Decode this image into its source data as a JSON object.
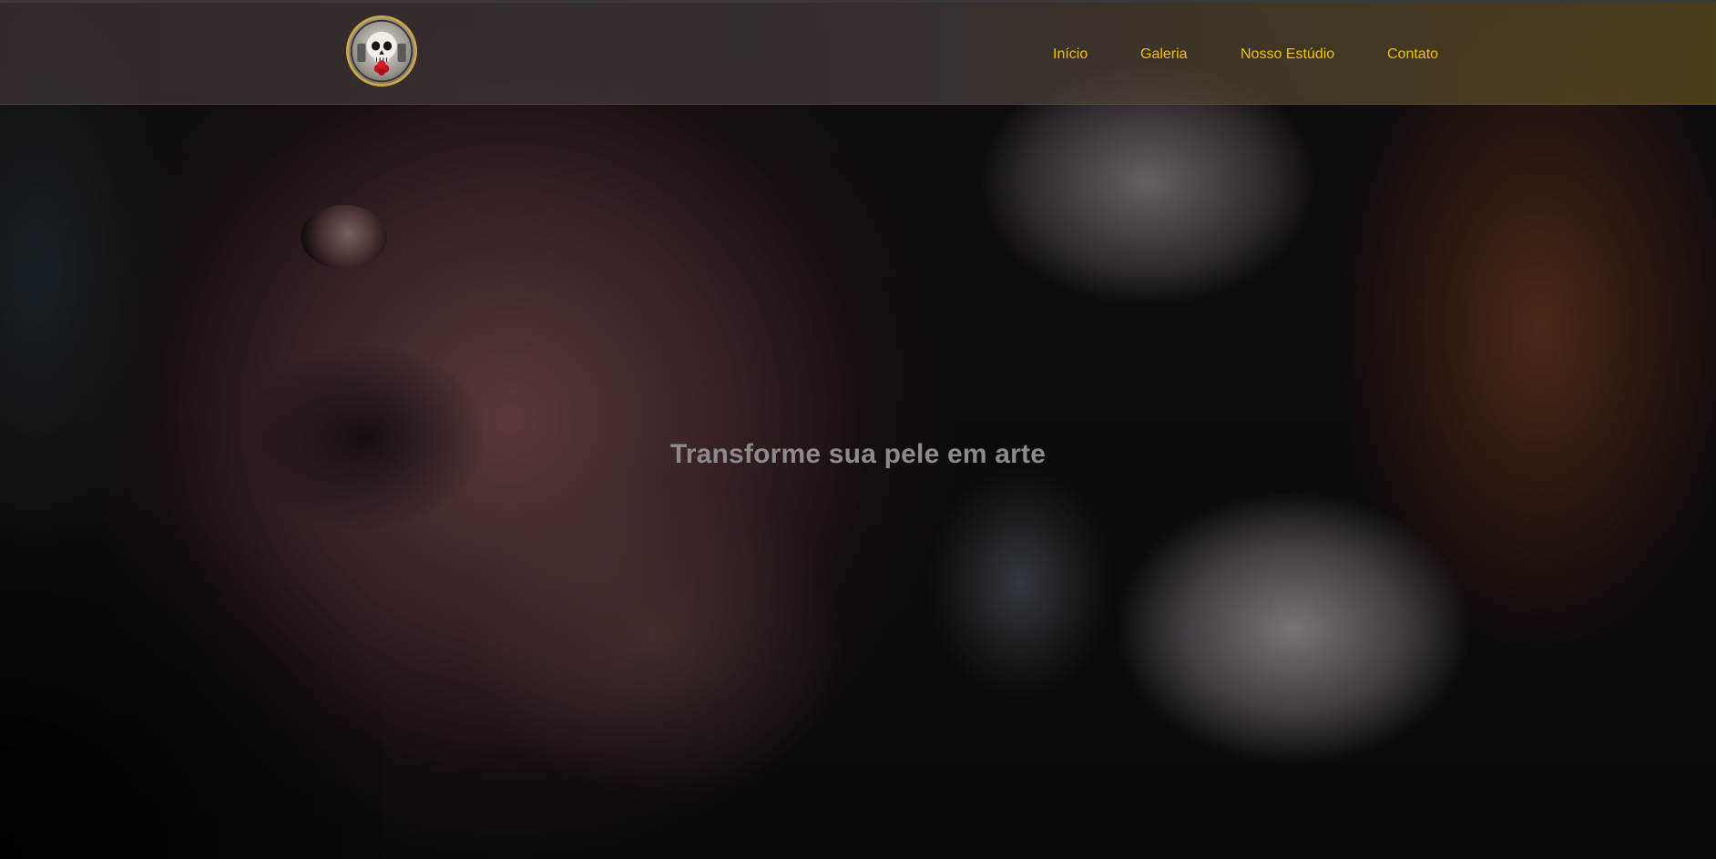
{
  "header": {
    "logo_name": "skull-logo",
    "nav": [
      {
        "label": "Início"
      },
      {
        "label": "Galeria"
      },
      {
        "label": "Nosso Estúdio"
      },
      {
        "label": "Contato"
      }
    ]
  },
  "hero": {
    "title": "Transforme sua pele em arte",
    "image_description_icon": "tattoo-background-image"
  },
  "colors": {
    "nav_link": "#f2c200",
    "hero_text": "#8e8a8c",
    "logo_ring": "#c9a64a"
  }
}
